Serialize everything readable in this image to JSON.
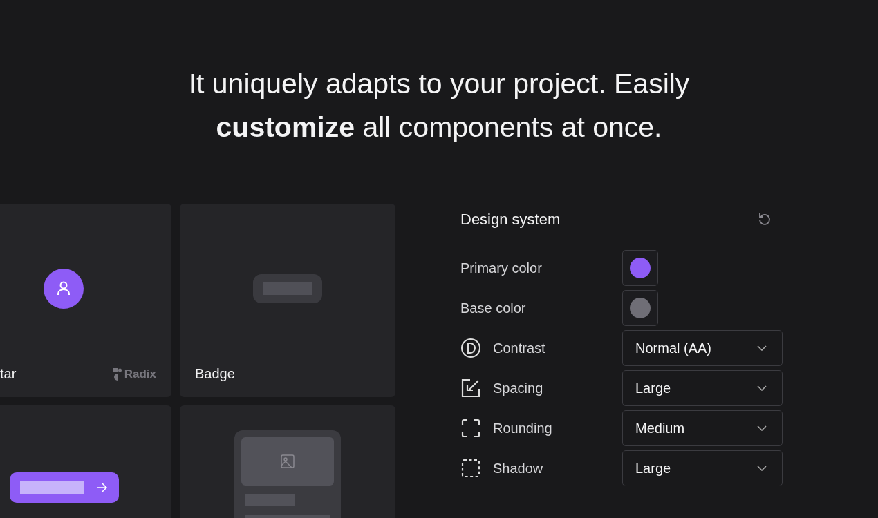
{
  "headline": "It uniquely adapts to your project. Easily **customize** all components at once.",
  "cards": [
    {
      "kind": "avatar",
      "label": "tar",
      "brand": "Radix"
    },
    {
      "kind": "badge",
      "label": "Badge"
    },
    {
      "kind": "button"
    },
    {
      "kind": "card"
    }
  ],
  "panel": {
    "title": "Design system",
    "settings": [
      {
        "kind": "color",
        "label": "Primary color",
        "color": "#8e5cf6"
      },
      {
        "kind": "color",
        "label": "Base color",
        "color": "#6f6e76"
      },
      {
        "kind": "select",
        "label": "Contrast",
        "value": "Normal (AA)"
      },
      {
        "kind": "select",
        "label": "Spacing",
        "value": "Large"
      },
      {
        "kind": "select",
        "label": "Rounding",
        "value": "Medium"
      },
      {
        "kind": "select",
        "label": "Shadow",
        "value": "Large"
      }
    ]
  }
}
